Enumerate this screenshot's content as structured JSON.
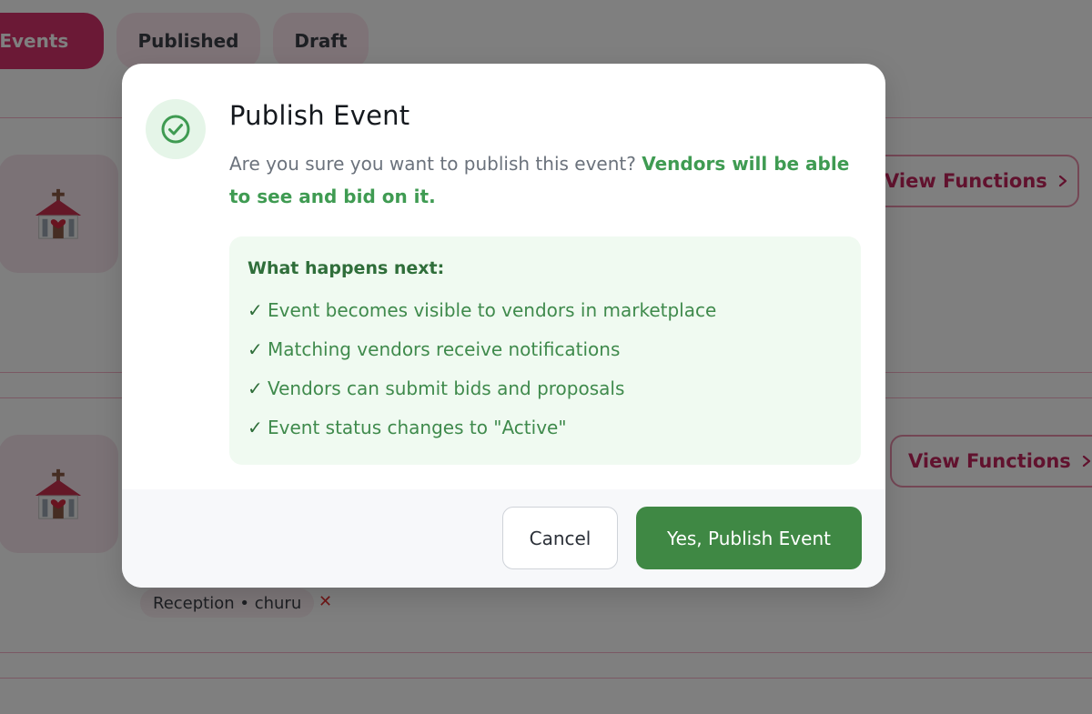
{
  "tabs": {
    "all_label": "ll Events",
    "published_label": "Published",
    "draft_label": "Draft"
  },
  "events": [
    {
      "icon": "church-icon",
      "view_label": "View Functions"
    },
    {
      "icon": "church-icon",
      "view_label": "View Functions"
    }
  ],
  "tag": {
    "label": "Reception • churu",
    "remove_glyph": "✕"
  },
  "modal": {
    "icon": "check-circle-icon",
    "title": "Publish Event",
    "desc_prefix": "Are you sure you want to publish this event? ",
    "desc_emphasis": "Vendors will be able to see and bid on it.",
    "info_heading": "What happens next:",
    "check_glyph": "✓",
    "info_items": [
      "Event becomes visible to vendors in marketplace",
      "Matching vendors receive notifications",
      "Vendors can submit bids and proposals",
      "Event status changes to \"Active\""
    ],
    "cancel_label": "Cancel",
    "confirm_label": "Yes, Publish Event"
  },
  "colors": {
    "brand_pink": "#d6336c",
    "success_green": "#3f8844",
    "overlay": "rgba(0,0,0,0.5)"
  }
}
